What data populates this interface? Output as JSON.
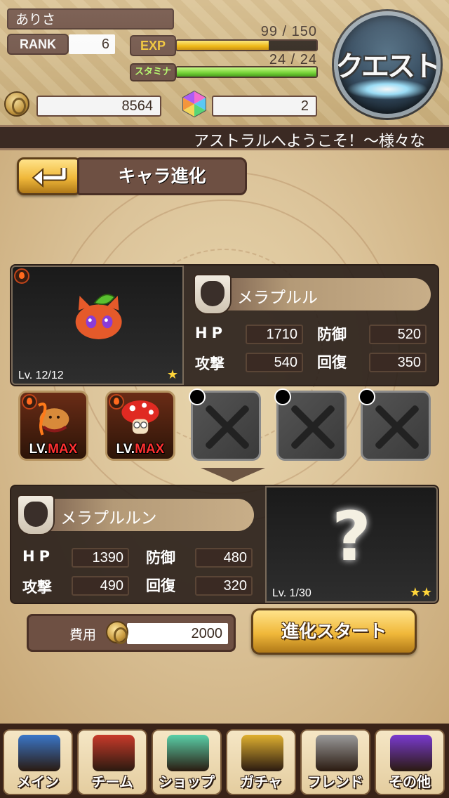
{
  "header": {
    "player_name": "ありさ",
    "rank_label": "RANK",
    "rank_value": "6",
    "exp_label": "EXP",
    "exp_text": "99 / 150",
    "exp_fraction": 0.66,
    "stamina_label": "スタミナ",
    "stamina_text": "24 / 24",
    "stamina_fraction": 1.0,
    "money": "8564",
    "gems": "2",
    "quest_label": "クエスト"
  },
  "ticker": {
    "text": "アストラルへようこそ！〜様々な"
  },
  "screen": {
    "title": "キャラ進化"
  },
  "base_character": {
    "name": "メラプルル",
    "level": "Lv. 12/12",
    "stars": "★",
    "stats": {
      "hp_label": "HP",
      "hp": "1710",
      "def_label": "防御",
      "def": "520",
      "atk_label": "攻撃",
      "atk": "540",
      "rec_label": "回復",
      "rec": "350"
    }
  },
  "materials": [
    {
      "state": "filled",
      "lv": "LV.",
      "max": "MAX"
    },
    {
      "state": "filled",
      "lv": "LV.",
      "max": "MAX"
    },
    {
      "state": "empty"
    },
    {
      "state": "empty"
    },
    {
      "state": "empty"
    }
  ],
  "result_character": {
    "name": "メラプルルン",
    "level": "Lv. 1/30",
    "stars": "★★",
    "unknown": "?",
    "stats": {
      "hp_label": "HP",
      "hp": "1390",
      "def_label": "防御",
      "def": "480",
      "atk_label": "攻撃",
      "atk": "490",
      "rec_label": "回復",
      "rec": "320"
    }
  },
  "cost": {
    "label": "費用",
    "value": "2000"
  },
  "start_button": {
    "label": "進化スタート"
  },
  "nav": [
    {
      "label": "メイン",
      "color": "#3a76c8"
    },
    {
      "label": "チーム",
      "color": "#c83a2a"
    },
    {
      "label": "ショップ",
      "color": "#5ad0a8"
    },
    {
      "label": "ガチャ",
      "color": "#e0b030"
    },
    {
      "label": "フレンド",
      "color": "#9a9a9a"
    },
    {
      "label": "その他",
      "color": "#7a3ad0"
    }
  ]
}
